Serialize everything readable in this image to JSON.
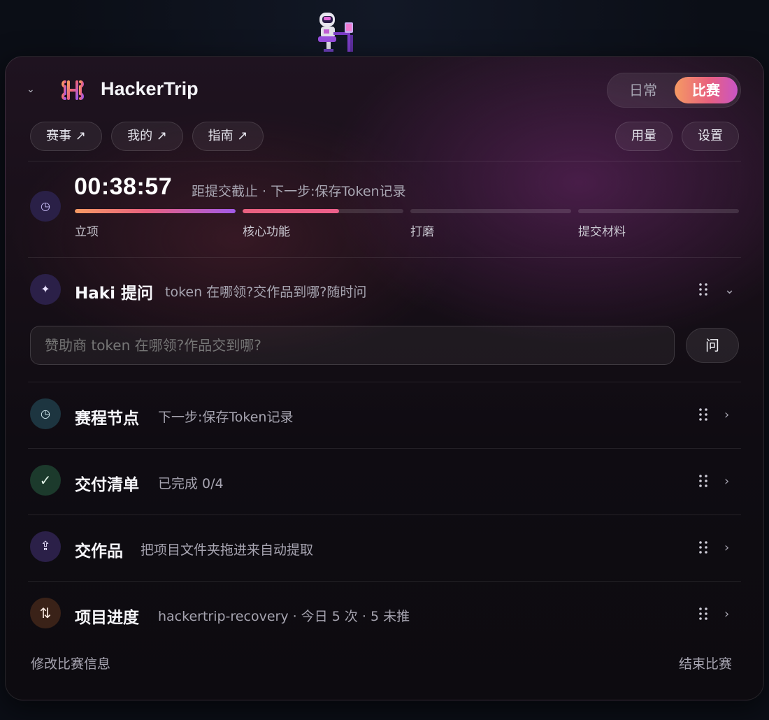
{
  "header": {
    "app_title": "HackerTrip",
    "mode_daily": "日常",
    "mode_contest": "比赛",
    "nav": [
      {
        "label": "赛事 ↗"
      },
      {
        "label": "我的 ↗"
      },
      {
        "label": "指南 ↗"
      }
    ],
    "usage_label": "用量",
    "settings_label": "设置"
  },
  "timer": {
    "countdown": "00:38:57",
    "subtitle": "距提交截止 · 下一步:保存Token记录",
    "stages": [
      {
        "label": "立项",
        "progress": 1.0
      },
      {
        "label": "核心功能",
        "progress": 0.6
      },
      {
        "label": "打磨",
        "progress": 0.0
      },
      {
        "label": "提交材料",
        "progress": 0.0
      }
    ]
  },
  "haki": {
    "title": "Haki 提问",
    "subtitle": "token 在哪领?交作品到哪?随时问",
    "input_placeholder": "赞助商 token 在哪领?作品交到哪?",
    "ask_label": "问"
  },
  "rows": [
    {
      "title": "赛程节点",
      "subtitle": "下一步:保存Token记录",
      "icon": "clock-icon"
    },
    {
      "title": "交付清单",
      "subtitle": "已完成 0/4",
      "icon": "check-icon"
    },
    {
      "title": "交作品",
      "subtitle": "把项目文件夹拖进来自动提取",
      "icon": "upload-icon"
    },
    {
      "title": "项目进度",
      "subtitle": "hackertrip-recovery · 今日 5 次 · 5 未推",
      "icon": "sync-arrows-icon"
    }
  ],
  "footer": {
    "edit_label": "修改比赛信息",
    "end_label": "结束比赛"
  },
  "colors": {
    "accent_start": "#f59a63",
    "accent_mid": "#e8607f",
    "accent_end": "#c955c6",
    "progress_purple": "#9b5cf0"
  }
}
